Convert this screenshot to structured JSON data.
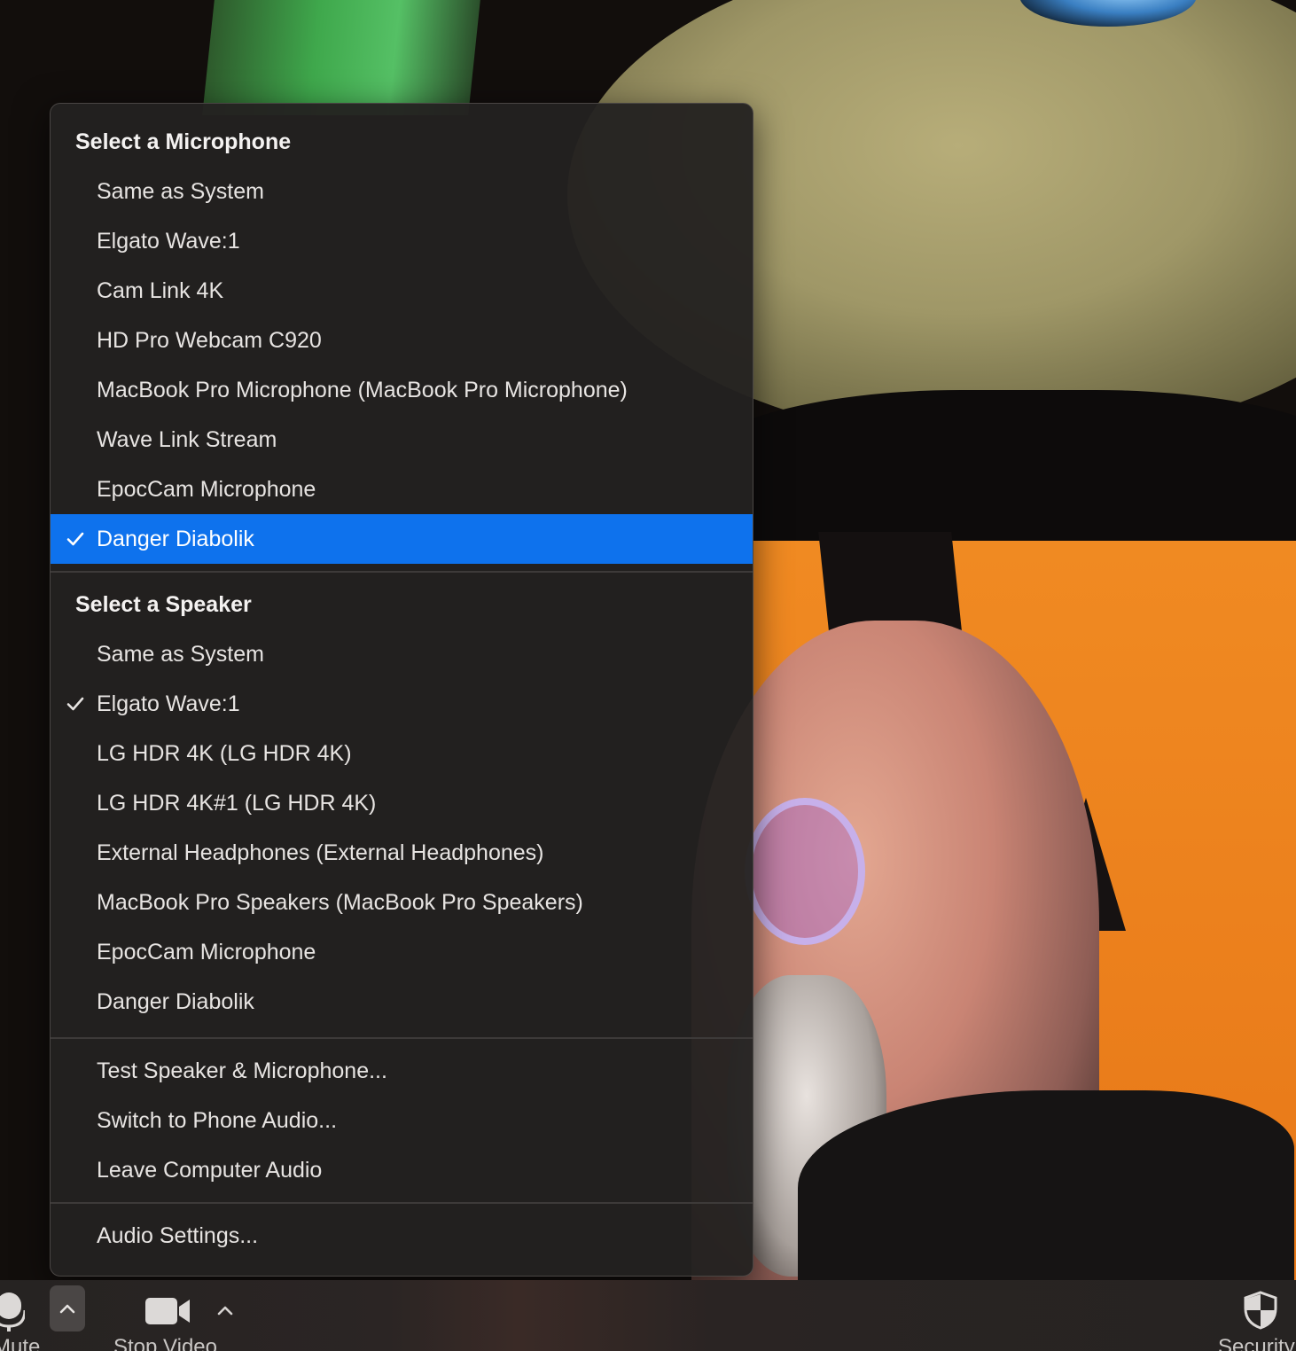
{
  "menu": {
    "microphone_header": "Select a Microphone",
    "microphones": [
      {
        "label": "Same as System",
        "checked": false
      },
      {
        "label": "Elgato Wave:1",
        "checked": false
      },
      {
        "label": "Cam Link 4K",
        "checked": false
      },
      {
        "label": "HD Pro Webcam C920",
        "checked": false
      },
      {
        "label": "MacBook Pro Microphone (MacBook Pro Microphone)",
        "checked": false
      },
      {
        "label": "Wave Link Stream",
        "checked": false
      },
      {
        "label": "EpocCam Microphone",
        "checked": false
      },
      {
        "label": "Danger Diabolik",
        "checked": true
      }
    ],
    "speaker_header": "Select a Speaker",
    "speakers": [
      {
        "label": "Same as System",
        "checked": false
      },
      {
        "label": "Elgato Wave:1",
        "checked": true
      },
      {
        "label": "LG HDR 4K (LG HDR 4K)",
        "checked": false
      },
      {
        "label": "LG HDR 4K#1 (LG HDR 4K)",
        "checked": false
      },
      {
        "label": "External Headphones (External Headphones)",
        "checked": false
      },
      {
        "label": "MacBook Pro Speakers (MacBook Pro Speakers)",
        "checked": false
      },
      {
        "label": "EpocCam Microphone",
        "checked": false
      },
      {
        "label": "Danger Diabolik",
        "checked": false
      }
    ],
    "actions": [
      {
        "label": "Test Speaker & Microphone..."
      },
      {
        "label": "Switch to Phone Audio..."
      },
      {
        "label": "Leave Computer Audio"
      }
    ],
    "settings_label": "Audio Settings..."
  },
  "toolbar": {
    "mute_label": "Mute",
    "video_label": "Stop Video",
    "security_label": "Security",
    "icons": {
      "microphone": "microphone-icon",
      "audio_options": "chevron-up-icon",
      "camera": "video-camera-icon",
      "video_options": "chevron-up-icon",
      "security": "shield-icon"
    }
  },
  "colors": {
    "selected_highlight": "#0e72ed",
    "menu_background": "#242120",
    "menu_text": "#e7e4e2"
  }
}
